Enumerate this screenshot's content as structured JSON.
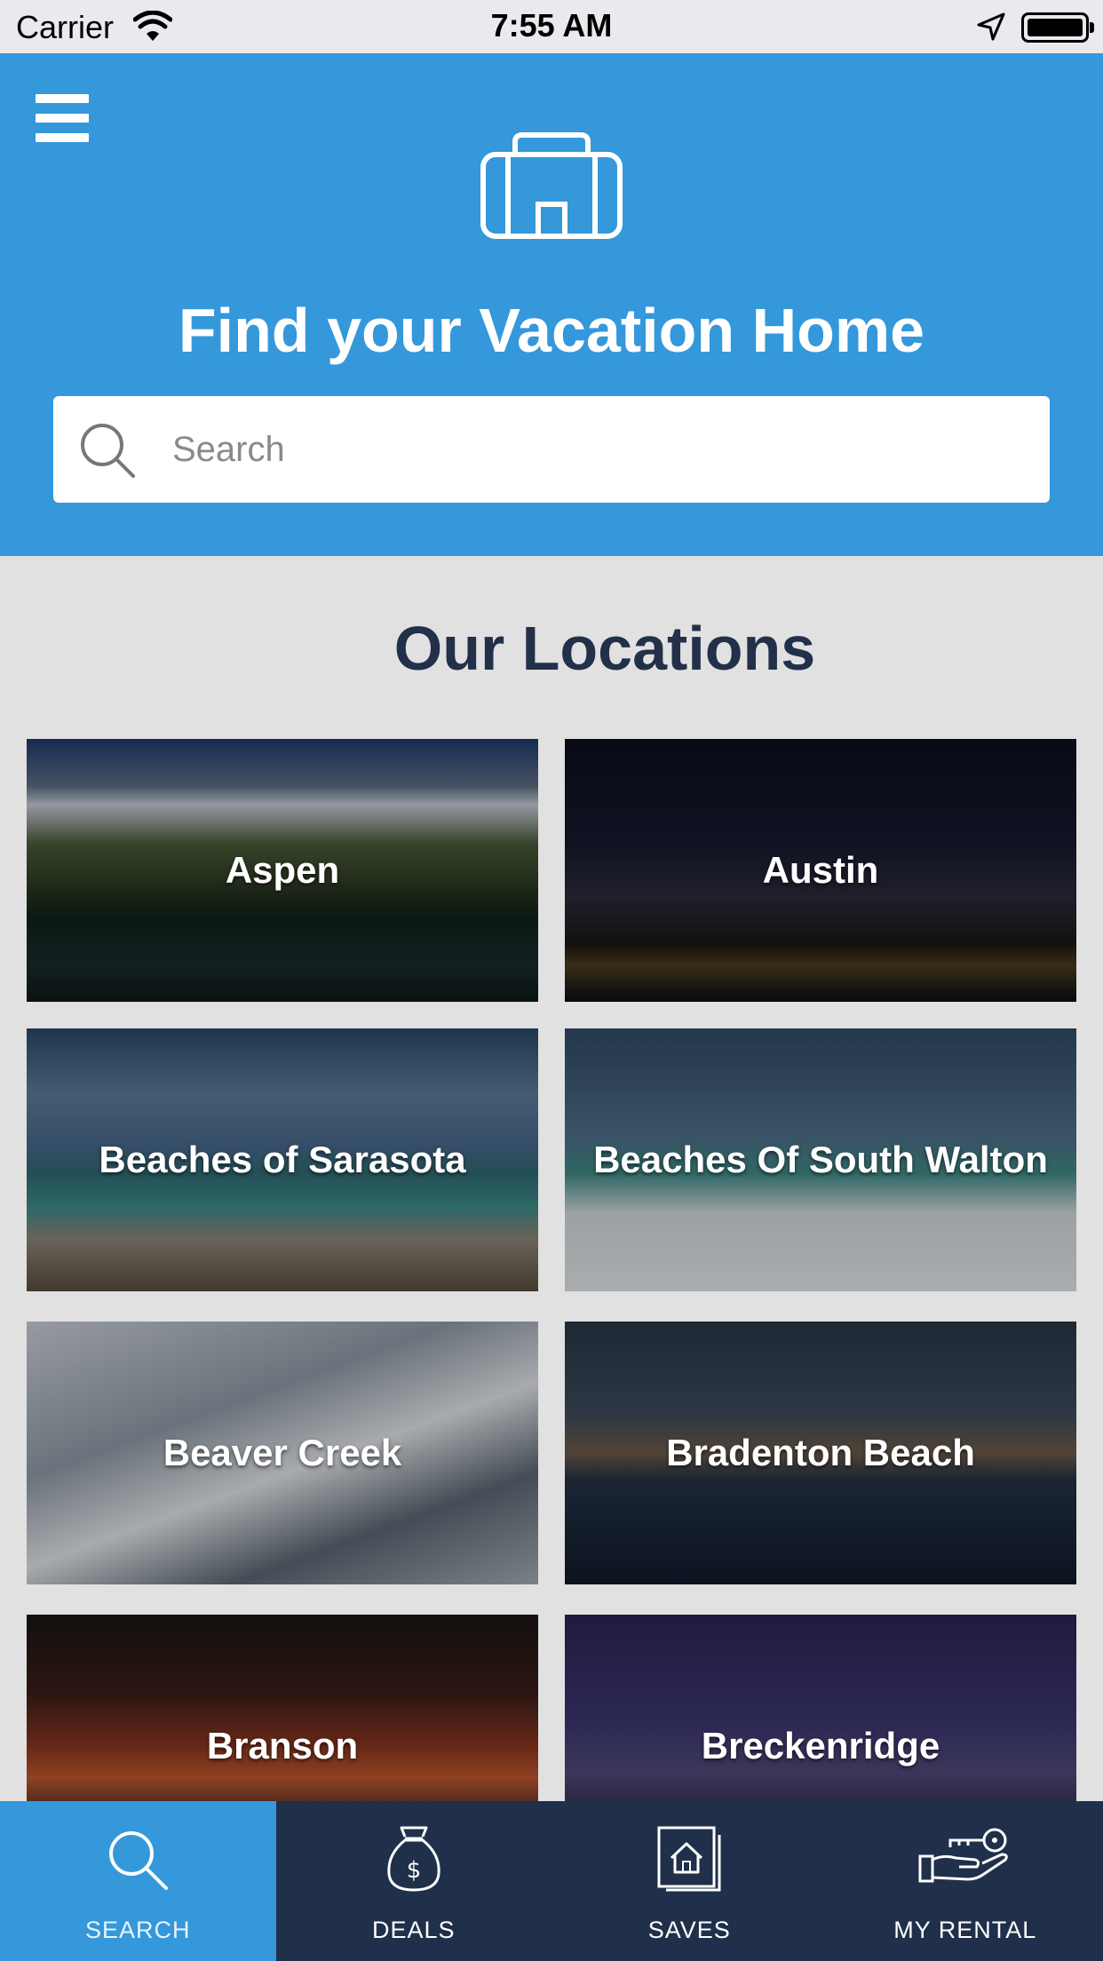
{
  "status_bar": {
    "carrier": "Carrier",
    "time": "7:55 AM"
  },
  "header": {
    "title": "Find your Vacation Home",
    "search_placeholder": "Search",
    "accent_color": "#3498db"
  },
  "locations_title": "Our Locations",
  "locations": [
    {
      "name": "Aspen"
    },
    {
      "name": "Austin"
    },
    {
      "name": "Beaches of Sarasota"
    },
    {
      "name": "Beaches Of South Walton"
    },
    {
      "name": "Beaver Creek"
    },
    {
      "name": "Bradenton Beach"
    },
    {
      "name": "Branson"
    },
    {
      "name": "Breckenridge"
    }
  ],
  "tab_bar": {
    "tabs": [
      {
        "label": "SEARCH",
        "icon": "search-icon",
        "active": true
      },
      {
        "label": "DEALS",
        "icon": "money-bag-icon",
        "active": false
      },
      {
        "label": "SAVES",
        "icon": "saved-home-icon",
        "active": false
      },
      {
        "label": "MY RENTAL",
        "icon": "key-hand-icon",
        "active": false
      }
    ],
    "background_color": "#20304a"
  }
}
